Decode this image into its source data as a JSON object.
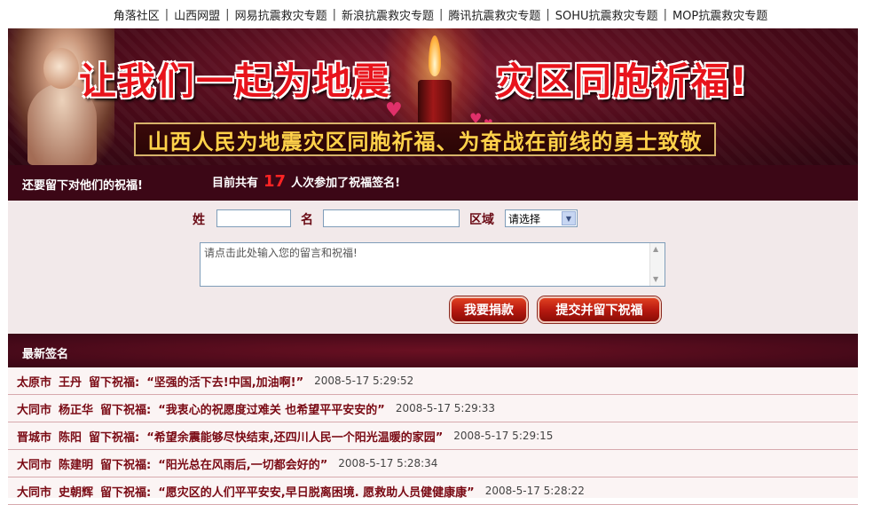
{
  "topnav": {
    "links": [
      "角落社区",
      "山西网盟",
      "网易抗震救灾专题",
      "新浪抗震救灾专题",
      "腾讯抗震救灾专题",
      "SOHU抗震救灾专题",
      "MOP抗震救灾专题"
    ]
  },
  "banner": {
    "title_left": "让我们一起为地震",
    "title_right": "灾区同胞祈福!",
    "subtitle": "山西人民为地震灾区同胞祈福、为奋战在前线的勇士致敬"
  },
  "info": {
    "prompt": "还要留下对他们的祝福!",
    "count_prefix": "目前共有",
    "count": "17",
    "count_suffix": "人次参加了祝福签名!"
  },
  "form": {
    "surname_label": "姓",
    "name_label": "名",
    "region_label": "区域",
    "region_selected": "请选择",
    "message_placeholder": "请点击此处输入您的留言和祝福!",
    "donate_button": "我要捐款",
    "submit_button": "提交并留下祝福"
  },
  "latest": {
    "header": "最新签名",
    "entries": [
      {
        "city": "太原市",
        "name": "王丹",
        "verb": "留下祝福:",
        "message": "“坚强的活下去!中国,加油啊!”",
        "time": "2008-5-17 5:29:52"
      },
      {
        "city": "大同市",
        "name": "杨正华",
        "verb": "留下祝福:",
        "message": "“我衷心的祝愿度过难关 也希望平平安安的”",
        "time": "2008-5-17 5:29:33"
      },
      {
        "city": "晋城市",
        "name": "陈阳",
        "verb": "留下祝福:",
        "message": "“希望余震能够尽快结束,还四川人民一个阳光温暖的家园”",
        "time": "2008-5-17 5:29:15"
      },
      {
        "city": "大同市",
        "name": "陈建明",
        "verb": "留下祝福:",
        "message": "“阳光总在风雨后,一切都会好的”",
        "time": "2008-5-17 5:28:34"
      },
      {
        "city": "大同市",
        "name": "史朝辉",
        "verb": "留下祝福:",
        "message": "“愿灾区的人们平平安安,早日脱离困境. 愿救助人员健健康康”",
        "time": "2008-5-17 5:28:22"
      }
    ]
  }
}
